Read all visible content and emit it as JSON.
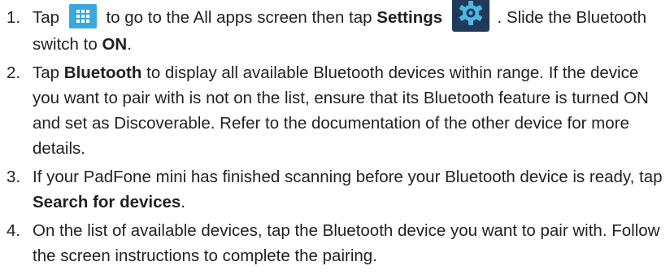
{
  "steps": [
    {
      "number": "1.",
      "parts": {
        "a": "Tap",
        "b": "to go to the All apps screen then tap",
        "settings_bold": "Settings",
        "c": ". Slide the Bluetooth switch to",
        "on_bold": "ON",
        "d": "."
      },
      "icons": [
        "all-apps-icon",
        "settings-gear-icon"
      ]
    },
    {
      "number": "2.",
      "parts": {
        "a": "Tap",
        "bluetooth_bold": "Bluetooth",
        "b": "to display all available Bluetooth devices within range. If the device you want to pair with is not on the list, ensure that its Bluetooth feature is turned ON and set as Discoverable. Refer to the documentation of the other device for more details."
      }
    },
    {
      "number": "3.",
      "parts": {
        "a": "If your PadFone mini has finished scanning before your Bluetooth device is ready, tap",
        "search_bold": "Search for devices",
        "b": "."
      }
    },
    {
      "number": "4.",
      "parts": {
        "a": "On the list of available devices, tap the Bluetooth device you want to pair with. Follow the screen instructions to complete the pairing."
      }
    }
  ],
  "colors": {
    "text": "#231f20",
    "apps_icon_bg": "#3aa8dc",
    "settings_icon_bg": "#1f3b57",
    "settings_gear": "#4fb6e6"
  }
}
